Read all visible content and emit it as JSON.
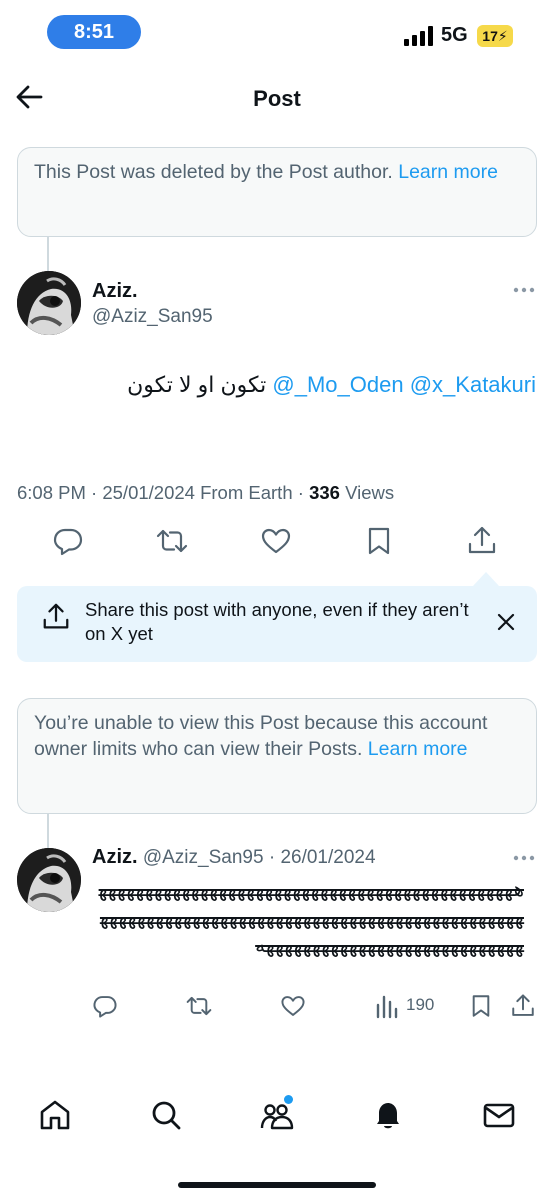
{
  "status": {
    "time": "8:51",
    "network": "5G",
    "battery": "17"
  },
  "header": {
    "title": "Post"
  },
  "deleted_notice": {
    "text": "This Post was deleted by the Post author. ",
    "link": "Learn more"
  },
  "post": {
    "author_name": "Aziz.",
    "author_handle": "@Aziz_San95",
    "mention1": "@x_Katakuri",
    "mention2": "@_Mo_Oden",
    "text": "تكون او لا تكون",
    "time": "6:08 PM",
    "date": "25/01/2024",
    "location": "From Earth",
    "views_count": "336",
    "views_label": "Views"
  },
  "share_banner": {
    "text": "Share this post with anyone, even if they aren’t on X yet"
  },
  "limited_notice": {
    "text": "You’re unable to view this Post because this account owner limits who can view their Posts. ",
    "link": "Learn more"
  },
  "reply": {
    "author_name": "Aziz.",
    "author_handle": "@Aziz_San95",
    "date": "26/01/2024",
    "body": "ههههههههههههههههههههههههههههههههههههههههههههههههههههههههههههههههههههههههههههههههههههههههههههههههههههههههههههههههههههههههه",
    "views": "190"
  },
  "icons": {
    "back": "arrow-left-icon",
    "more": "more-horizontal-icon",
    "reply": "reply-icon",
    "repost": "repost-icon",
    "like": "heart-icon",
    "bookmark": "bookmark-icon",
    "share": "share-icon",
    "close": "close-icon",
    "views": "bar-chart-icon",
    "home": "home-icon",
    "search": "search-icon",
    "communities": "people-icon",
    "notifications": "bell-icon",
    "messages": "envelope-icon"
  },
  "colors": {
    "accent": "#1d9bf0",
    "share_banner_bg": "#e8f5fd",
    "time_pill": "#2f7ee8",
    "battery": "#f6d94a"
  }
}
